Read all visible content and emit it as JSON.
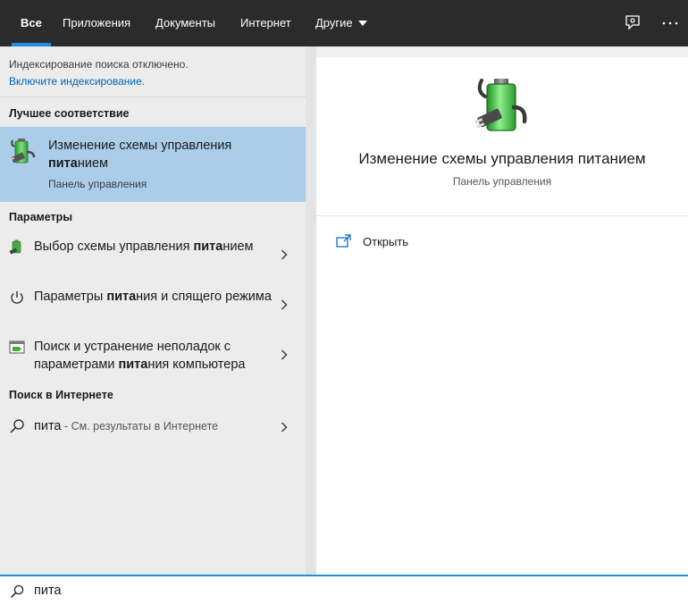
{
  "tabs": [
    {
      "label": "Все",
      "active": true
    },
    {
      "label": "Приложения"
    },
    {
      "label": "Документы"
    },
    {
      "label": "Интернет"
    },
    {
      "label": "Другие",
      "dropdown": true
    }
  ],
  "top_icons": [
    "feedback-icon",
    "more-options-icon"
  ],
  "notice": {
    "text": "Индексирование поиска отключено.",
    "link": "Включите индексирование."
  },
  "best_match": {
    "section_title": "Лучшее соответствие",
    "title_before": "Изменение схемы управления",
    "title_highlight": "пита",
    "title_after": "нием",
    "subtitle": "Панель управления",
    "icon": "battery-plug-icon"
  },
  "settings": {
    "section_title": "Параметры",
    "items": [
      {
        "pre": "Выбор схемы управления",
        "highlight": "пита",
        "post": "нием",
        "icon": "battery-plug-icon"
      },
      {
        "pre": "Параметры",
        "highlight": "пита",
        "post": "ния и спящего режима",
        "icon": "power-icon"
      },
      {
        "pre": "Поиск и устранение неполадок с параметрами",
        "highlight": "пита",
        "post": "ния компьютера",
        "icon": "troubleshoot-icon"
      }
    ]
  },
  "web": {
    "section_title": "Поиск в Интернете",
    "query": "пита",
    "hint": " - См. результаты в Интернете"
  },
  "preview": {
    "title": "Изменение схемы управления питанием",
    "subtitle": "Панель управления",
    "open_label": "Открыть"
  },
  "search": {
    "value": "пита",
    "placeholder": ""
  },
  "colors": {
    "topbar": "#2b2b2b",
    "accent": "#1f8fe0",
    "selected": "#aacdea",
    "link": "#0063b1"
  }
}
